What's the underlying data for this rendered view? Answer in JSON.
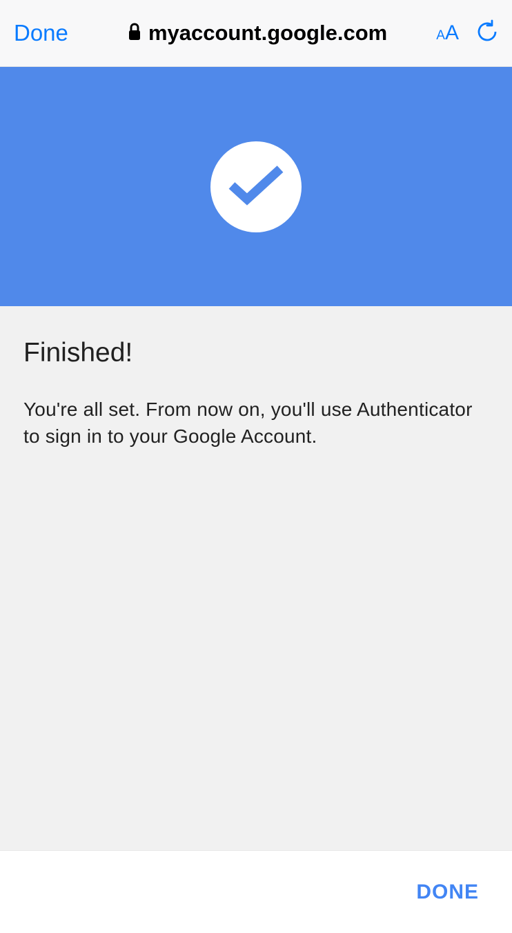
{
  "browser": {
    "done_label": "Done",
    "url": "myacc﻿ount.google.com",
    "text_size_small": "A",
    "text_size_large": "A"
  },
  "content": {
    "heading": "Finished!",
    "body": "You're all set. From now on, you'll use Authenticator to sign in to your Google Account."
  },
  "footer": {
    "done_button": "DONE"
  }
}
